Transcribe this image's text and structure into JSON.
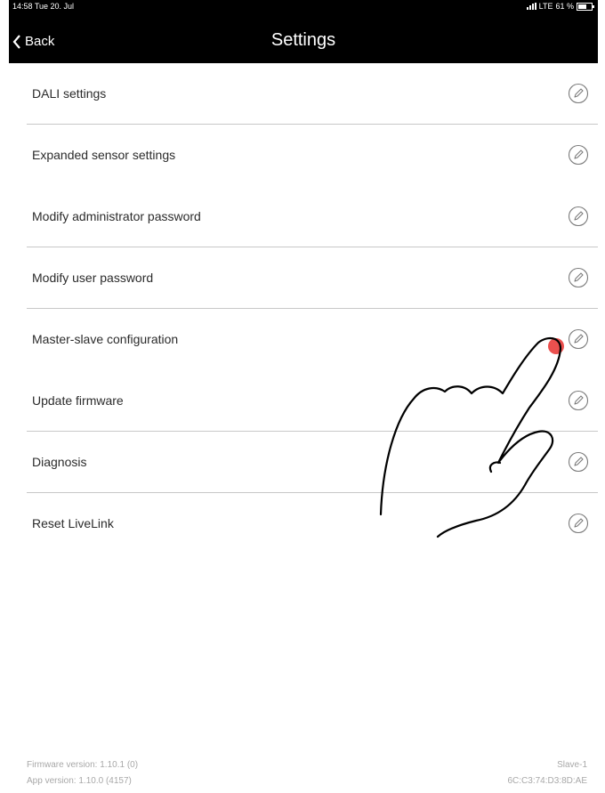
{
  "status_bar": {
    "time": "14:58  Tue 20. Jul",
    "network": "LTE",
    "battery": "61 %"
  },
  "nav": {
    "back_label": "Back",
    "title": "Settings"
  },
  "settings": [
    {
      "label": "DALI settings"
    },
    {
      "label": "Expanded sensor settings"
    },
    {
      "label": "Modify administrator password"
    },
    {
      "label": "Modify user password"
    },
    {
      "label": "Master-slave configuration"
    },
    {
      "label": "Update firmware"
    },
    {
      "label": "Diagnosis"
    },
    {
      "label": "Reset LiveLink"
    }
  ],
  "footer": {
    "firmware_version": "Firmware version: 1.10.1 (0)",
    "app_version": "App version: 1.10.0 (4157)",
    "role": "Slave-1",
    "mac_address": "6C:C3:74:D3:8D:AE"
  },
  "colors": {
    "header_bg": "#000000",
    "touch_indicator": "#e8312f"
  }
}
